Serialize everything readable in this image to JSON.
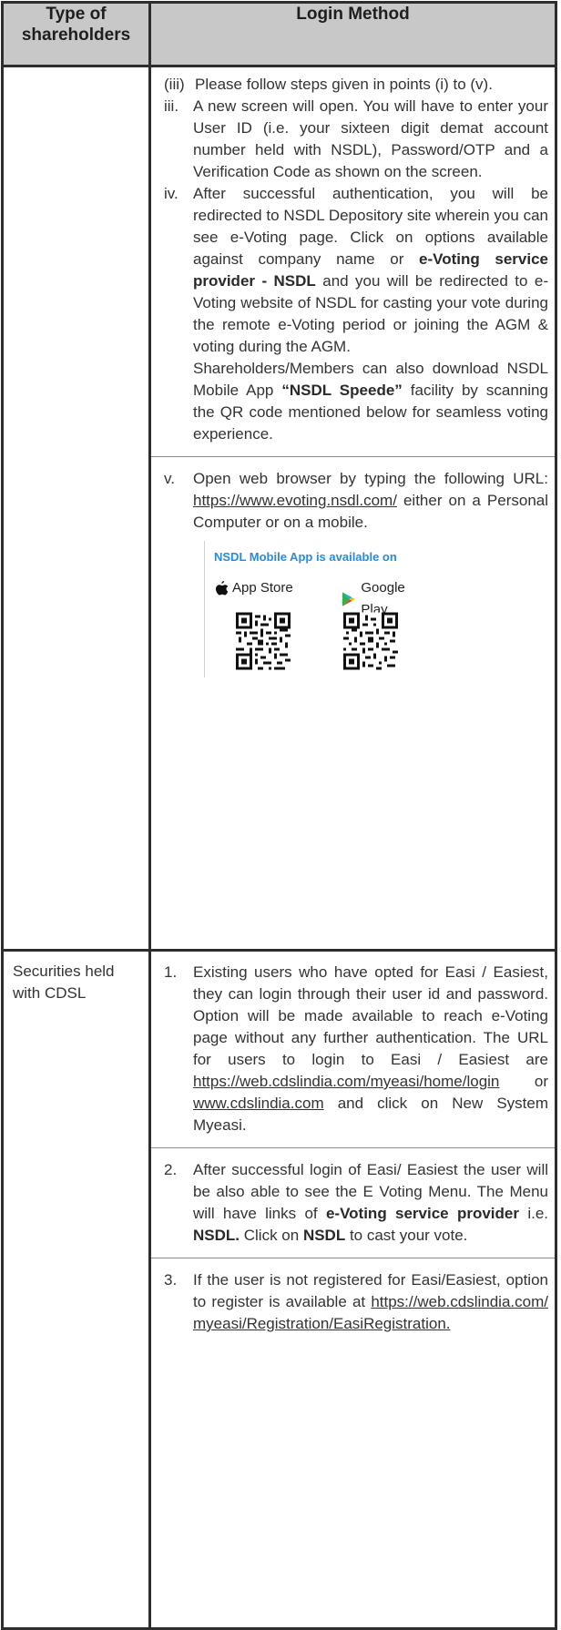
{
  "header": {
    "col1": "Type of shareholders",
    "col2": "Login Method"
  },
  "row_nsdl": {
    "items": [
      {
        "num": "(iii)",
        "text": "Please follow steps given in points (i) to (v)."
      },
      {
        "num": "iii.",
        "text": "A new screen will open. You will have to enter your User ID (i.e. your sixteen digit demat account number held with NSDL), Password/OTP and a Verification Code as shown on the screen."
      },
      {
        "num": "iv.",
        "p1": "After successful authentication, you will be redirected to NSDL Depository site wherein you can see e-Voting page. Click on options available against company name or",
        "bold1": "e-Voting service provider - NSDL",
        "p2": "and you will be redirected to e-Voting website of NSDL for casting your vote during the remote e-Voting period or joining the AGM & voting during the AGM.",
        "p3": "Shareholders/Members can also download NSDL Mobile App",
        "bold2": "“NSDL Speede”",
        "p4": "facility by scanning the QR code mentioned below for seamless voting experience."
      },
      {
        "num": "v.",
        "p1": "Open web browser by typing the following URL:",
        "link": "https://www.evoting.nsdl.com/",
        "p2": "either on a Personal Computer or on a mobile."
      }
    ],
    "app_badge": {
      "title": "NSDL Mobile App is available on",
      "app_store": "App Store",
      "google_play": "Google Play",
      "title_color": "#2a8bd6"
    }
  },
  "row_cdsl": {
    "type": "Securities held with CDSL",
    "items": [
      {
        "num": "1.",
        "p1": "Existing users who have opted for Easi / Easiest, they can login through their user id and password. Option will be made available to reach e-Voting page without any further authentication. The URL for users to login to Easi / Easiest are",
        "link1": "https://web.cdslindia.com/myeasi/home/login",
        "mid": "or",
        "link2": "www.cdslindia.com",
        "p2": "and click on New System Myeasi."
      },
      {
        "num": "2.",
        "p1": "After successful login of Easi/ Easiest the user will be also able to see the E Voting Menu. The Menu will have links of",
        "bold1": "e-Voting service provider",
        "p2": "i.e.",
        "bold2": "NSDL.",
        "p3": "Click on",
        "bold3": "NSDL",
        "p4": "to cast your vote."
      },
      {
        "num": "3.",
        "p1": "If the user is not registered for Easi/Easiest, option to register is available at",
        "link": "https://web.cdslindia.com/myeasi/Registration/EasiRegistration."
      }
    ]
  },
  "colors": {
    "header_bg": "#c8c8c8",
    "border": "#2d2d2d"
  }
}
